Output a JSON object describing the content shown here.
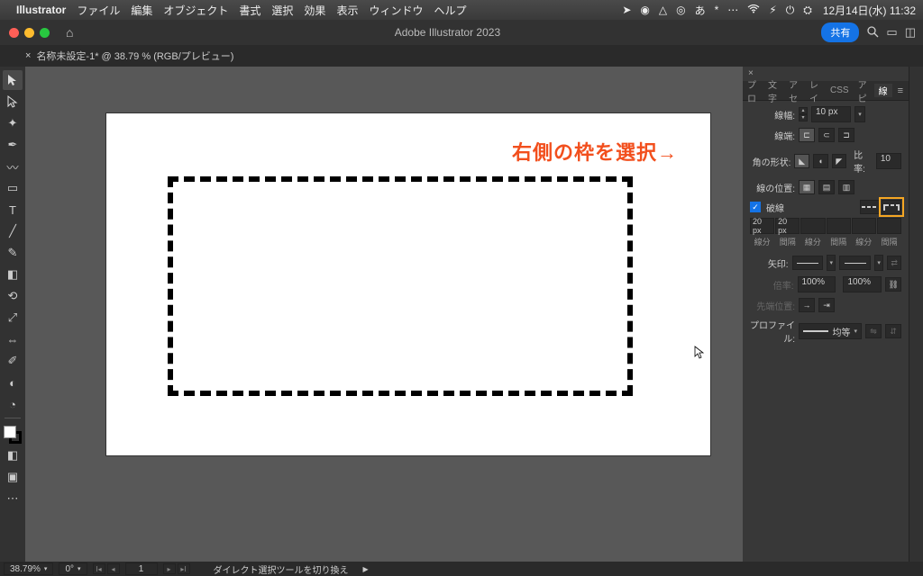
{
  "menubar": {
    "app_name": "Illustrator",
    "items": [
      "ファイル",
      "編集",
      "オブジェクト",
      "書式",
      "選択",
      "効果",
      "表示",
      "ウィンドウ",
      "ヘルプ"
    ],
    "status_icons": [
      "➤",
      "◉",
      "△",
      "◎",
      "あ",
      "*",
      "⋯",
      "⚡︎",
      "⏻",
      "⛭"
    ],
    "clock": "12月14日(水)  11:32"
  },
  "appbar": {
    "title": "Adobe Illustrator 2023",
    "share_label": "共有"
  },
  "doc_tab": "名称未設定-1* @ 38.79 % (RGB/プレビュー)",
  "annotation": "右側の枠を選択→",
  "panel": {
    "tabs": [
      "プロ",
      "文字",
      "アセ",
      "レイ",
      "CSS",
      "アピ",
      "線"
    ],
    "stroke_label": "線幅:",
    "stroke_value": "10 px",
    "cap_label": "線端:",
    "corner_label": "角の形状:",
    "ratio_label": "比率:",
    "ratio_value": "10",
    "align_label": "線の位置:",
    "dash_label": "破線",
    "dash_values": [
      "20 px",
      "20 px",
      "",
      "",
      "",
      ""
    ],
    "dash_sub_labels": [
      "線分",
      "間隔",
      "線分",
      "間隔",
      "線分",
      "間隔"
    ],
    "arrow_label": "矢印:",
    "scale_label": "倍率:",
    "scale_a": "100%",
    "scale_b": "100%",
    "tip_label": "先端位置:",
    "profile_label": "プロファイル:",
    "profile_value": "均等"
  },
  "statusbar": {
    "zoom": "38.79%",
    "rotate": "0°",
    "page": "1",
    "hint": "ダイレクト選択ツールを切り換え"
  }
}
